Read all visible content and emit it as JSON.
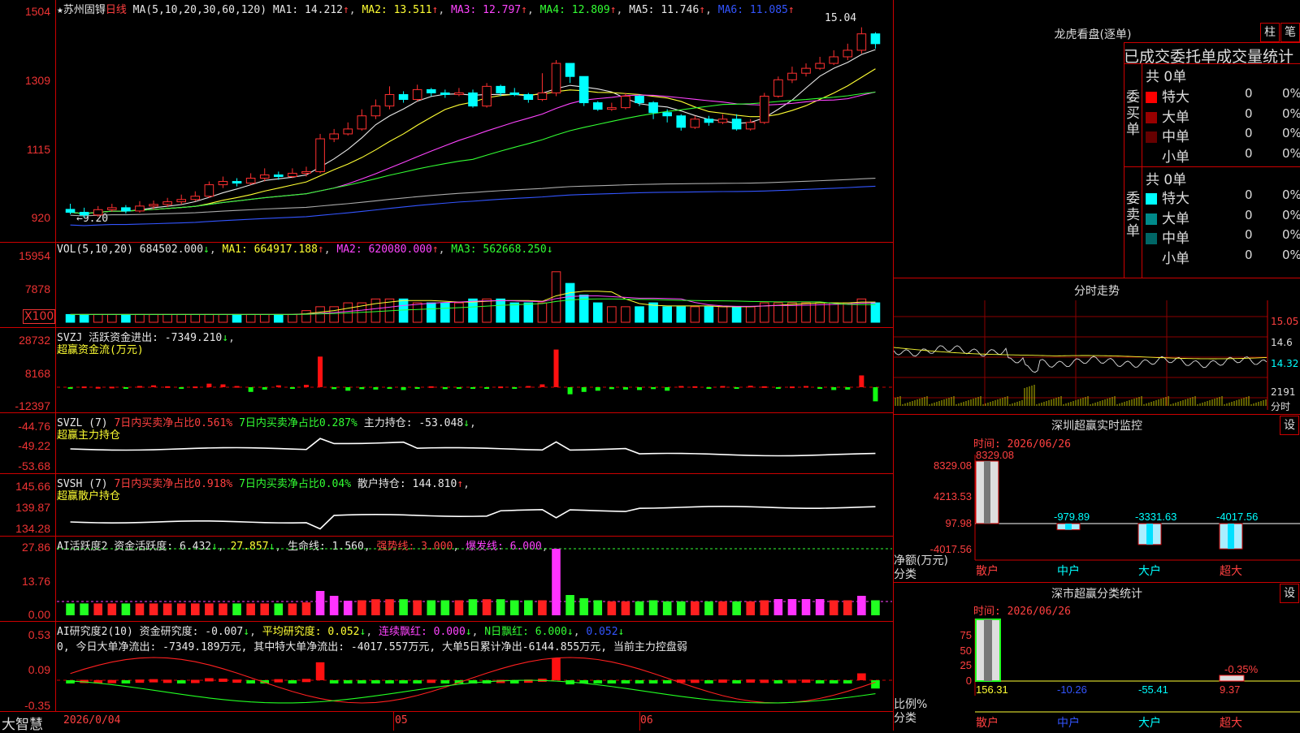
{
  "stock": {
    "name": "★苏州固锝",
    "period": "日线",
    "ma_label": "MA(5,10,20,30,60,120)"
  },
  "main_panel": {
    "ma_values": [
      {
        "label": "MA1: 14.212",
        "color": "#e8e8e8"
      },
      {
        "label": "MA2: 13.511",
        "color": "#ffff33"
      },
      {
        "label": "MA3: 12.797",
        "color": "#ff44ff"
      },
      {
        "label": "MA4: 12.809",
        "color": "#33ff33"
      },
      {
        "label": "MA5: 11.746",
        "color": "#e8e8e8"
      },
      {
        "label": "MA6: 11.085",
        "color": "#3355ff"
      }
    ],
    "y_ticks": [
      "1504",
      "1309",
      "1115",
      "920"
    ],
    "high_label": "15.04",
    "low_label": "←9.20"
  },
  "vol_panel": {
    "header": "VOL(5,10,20)",
    "value": "684502.000",
    "ma1": "MA1: 664917.188",
    "ma2": "MA2: 620080.000",
    "ma3": "MA3: 562668.250",
    "y_ticks": [
      "15954",
      "7878"
    ],
    "unit": "X100"
  },
  "svzj_panel": {
    "header": "SVZJ  活跃资金进出: -7349.210",
    "sub": "超赢资金流(万元)",
    "y_ticks": [
      "28732",
      "8168",
      "-12397"
    ]
  },
  "svzl_panel": {
    "header": "SVZL (7)",
    "p1": "7日内买卖净占比0.561%",
    "p2": "7日内买卖净占比0.287%",
    "p3": "主力持仓: -53.048",
    "sub": "超赢主力持仓",
    "y_ticks": [
      "-44.76",
      "-49.22",
      "-53.68"
    ]
  },
  "svsh_panel": {
    "header": "SVSH (7)",
    "p1": "7日内买卖净占比0.918%",
    "p2": "7日内买卖净占比0.04%",
    "p3": "散户持仓: 144.810",
    "sub": "超赢散户持仓",
    "y_ticks": [
      "145.66",
      "139.87",
      "134.28"
    ]
  },
  "ai_active_panel": {
    "header": "AI活跃度2 资金活跃度: 6.432",
    "v2": "27.857",
    "v3": "生命线: 1.560",
    "v4": "强势线: 3.000",
    "v5": "爆发线: 6.000",
    "y_ticks": [
      "27.86",
      "13.76",
      "0.00"
    ]
  },
  "ai_research_panel": {
    "header": "AI研究度2(10) 资金研究度: -0.007",
    "v2": "平均研究度: 0.052",
    "v3": "连续飘红: 0.000",
    "v4": "N日飘红: 6.000",
    "v5": "0.052",
    "note": "0, 今日大单净流出: -7349.189万元, 其中特大单净流出: -4017.557万元, 大单5日累计净出-6144.855万元, 当前主力控盘弱",
    "y_ticks": [
      "0.53",
      "0.09",
      "-0.35"
    ]
  },
  "x_axis": {
    "labels": [
      "2026/0/04",
      "05",
      "06"
    ]
  },
  "brand": "大智慧",
  "right_panel": {
    "lhb": {
      "title": "龙虎看盘(逐单)",
      "btn1": "柱",
      "btn2": "笔",
      "header": "已成交委托单成交量统计",
      "buy_label": "委买单",
      "sell_label": "委卖单",
      "buy_total": "共 0单",
      "sell_total": "共 0单",
      "buy_rows": [
        {
          "name": "特大",
          "count": "0",
          "pct": "0%",
          "color": "#ff0000"
        },
        {
          "name": "大单",
          "count": "0",
          "pct": "0%",
          "color": "#990000"
        },
        {
          "name": "中单",
          "count": "0",
          "pct": "0%",
          "color": "#660000"
        },
        {
          "name": "小单",
          "count": "0",
          "pct": "0%",
          "color": "#000000"
        }
      ],
      "sell_rows": [
        {
          "name": "特大",
          "count": "0",
          "pct": "0%",
          "color": "#00ffff"
        },
        {
          "name": "大单",
          "count": "0",
          "pct": "0%",
          "color": "#008a8a"
        },
        {
          "name": "中单",
          "count": "0",
          "pct": "0%",
          "color": "#006666"
        },
        {
          "name": "小单",
          "count": "0",
          "pct": "0%",
          "color": "#000000"
        }
      ]
    },
    "intraday": {
      "title": "分时走势",
      "ticks": [
        "15.05",
        "14.6",
        "14.32",
        "2191",
        "分时"
      ]
    },
    "monitor": {
      "title": "深圳超赢实时监控",
      "btn": "设",
      "time": "时间: 2026/06/26",
      "y_ticks": [
        "8329.08",
        "4213.53",
        "97.98",
        "-4017.56"
      ],
      "ylabel": "净额(万元)",
      "xlabel": "分类",
      "bars": [
        {
          "cat": "散户",
          "value": "8329.08"
        },
        {
          "cat": "中户",
          "value": "-979.89"
        },
        {
          "cat": "大户",
          "value": "-3331.63"
        },
        {
          "cat": "超大",
          "value": "-4017.56"
        }
      ]
    },
    "classify": {
      "title": "深市超赢分类统计",
      "btn": "设",
      "time": "时间: 2026/06/26",
      "y_ticks": [
        "75",
        "50",
        "25",
        "0"
      ],
      "ylabel": "比例%",
      "xlabel": "分类",
      "bars": [
        {
          "cat": "散户",
          "value": "156.31"
        },
        {
          "cat": "中户",
          "value": "-10.26"
        },
        {
          "cat": "大户",
          "value": "-55.41"
        },
        {
          "cat": "超大",
          "value": "9.37"
        }
      ],
      "top_label": "-0.35%"
    }
  },
  "chart_data": {
    "type": "candlestick",
    "ylim": [
      9.2,
      15.04
    ],
    "candles": [
      [
        9.45,
        9.36,
        9.62,
        9.3
      ],
      [
        9.36,
        9.28,
        9.5,
        9.2
      ],
      [
        9.28,
        9.44,
        9.55,
        9.22
      ],
      [
        9.44,
        9.5,
        9.62,
        9.38
      ],
      [
        9.5,
        9.4,
        9.58,
        9.32
      ],
      [
        9.4,
        9.55,
        9.7,
        9.35
      ],
      [
        9.55,
        9.6,
        9.72,
        9.45
      ],
      [
        9.6,
        9.68,
        9.8,
        9.52
      ],
      [
        9.68,
        9.75,
        9.9,
        9.6
      ],
      [
        9.75,
        9.85,
        10.0,
        9.7
      ],
      [
        9.85,
        10.2,
        10.3,
        9.8
      ],
      [
        10.2,
        10.3,
        10.45,
        10.1
      ],
      [
        10.3,
        10.25,
        10.4,
        10.15
      ],
      [
        10.25,
        10.4,
        10.55,
        10.2
      ],
      [
        10.4,
        10.5,
        10.7,
        10.3
      ],
      [
        10.5,
        10.45,
        10.6,
        10.35
      ],
      [
        10.45,
        10.55,
        10.7,
        10.4
      ],
      [
        10.55,
        10.6,
        10.75,
        10.45
      ],
      [
        10.6,
        11.6,
        11.75,
        10.55
      ],
      [
        11.6,
        11.75,
        11.9,
        11.5
      ],
      [
        11.75,
        11.9,
        12.1,
        11.7
      ],
      [
        11.9,
        12.3,
        12.5,
        11.85
      ],
      [
        12.3,
        12.6,
        12.8,
        12.2
      ],
      [
        12.6,
        12.95,
        13.2,
        12.5
      ],
      [
        12.95,
        12.8,
        13.05,
        12.7
      ],
      [
        12.8,
        13.1,
        13.25,
        12.75
      ],
      [
        13.1,
        13.0,
        13.15,
        12.9
      ],
      [
        13.0,
        12.95,
        13.1,
        12.85
      ],
      [
        12.95,
        13.0,
        13.15,
        12.9
      ],
      [
        13.0,
        12.6,
        13.1,
        12.55
      ],
      [
        12.6,
        13.2,
        13.3,
        12.55
      ],
      [
        13.2,
        13.0,
        13.25,
        12.9
      ],
      [
        13.0,
        12.95,
        13.15,
        12.9
      ],
      [
        12.95,
        12.8,
        13.0,
        12.7
      ],
      [
        12.8,
        13.0,
        13.6,
        12.75
      ],
      [
        13.0,
        13.9,
        14.0,
        12.9
      ],
      [
        13.9,
        13.5,
        13.9,
        13.3
      ],
      [
        13.5,
        12.7,
        13.5,
        12.6
      ],
      [
        12.7,
        12.5,
        12.75,
        12.45
      ],
      [
        12.5,
        12.55,
        12.7,
        12.45
      ],
      [
        12.55,
        12.9,
        13.0,
        12.5
      ],
      [
        12.9,
        12.7,
        12.95,
        12.6
      ],
      [
        12.7,
        12.4,
        12.75,
        12.2
      ],
      [
        12.4,
        12.3,
        12.5,
        12.1
      ],
      [
        12.3,
        11.95,
        12.35,
        11.85
      ],
      [
        11.95,
        12.2,
        12.3,
        11.9
      ],
      [
        12.2,
        12.1,
        12.3,
        12.0
      ],
      [
        12.1,
        12.2,
        12.35,
        12.05
      ],
      [
        12.2,
        11.9,
        12.35,
        11.85
      ],
      [
        11.9,
        12.1,
        12.2,
        11.85
      ],
      [
        12.1,
        12.9,
        13.0,
        12.05
      ],
      [
        12.9,
        13.4,
        13.5,
        12.85
      ],
      [
        13.4,
        13.6,
        13.8,
        13.3
      ],
      [
        13.6,
        13.75,
        13.9,
        13.5
      ],
      [
        13.75,
        13.9,
        14.1,
        13.7
      ],
      [
        13.9,
        14.1,
        14.3,
        13.85
      ],
      [
        14.1,
        14.3,
        14.5,
        14.0
      ],
      [
        14.3,
        14.8,
        15.0,
        14.2
      ],
      [
        14.8,
        14.5,
        14.85,
        14.35
      ]
    ],
    "volume": [
      2,
      2,
      2,
      2,
      2,
      2,
      2,
      2,
      2,
      2,
      2,
      2,
      2,
      2,
      2,
      2,
      2,
      3,
      4,
      4,
      5,
      5,
      6,
      6,
      6,
      5,
      5,
      5,
      5,
      6,
      6,
      6,
      5,
      5,
      5,
      13,
      10,
      7,
      5,
      4,
      4,
      4,
      5,
      4,
      4,
      4,
      4,
      4,
      4,
      4,
      5,
      5,
      5,
      5,
      5,
      5,
      5,
      6,
      5
    ],
    "svzj": [
      -0.5,
      0.3,
      0.1,
      0.2,
      -0.3,
      0.5,
      0.8,
      0.4,
      -0.6,
      0.3,
      1.5,
      1.2,
      0.5,
      -2,
      -1,
      0.8,
      -0.4,
      1,
      13,
      -0.8,
      -1.5,
      -0.8,
      -1,
      -0.6,
      -1.2,
      -0.5,
      0.4,
      -0.8,
      -0.6,
      -0.5,
      -0.4,
      0.3,
      -0.4,
      0.5,
      1.2,
      16,
      -3,
      -2,
      -1.5,
      -0.8,
      -1,
      -1.2,
      -0.8,
      -1.5,
      0.5,
      0.4,
      -0.3,
      0.5,
      -0.4,
      0.6,
      0.4,
      -0.6,
      0.3,
      0.5,
      -0.5,
      -1.2,
      -1,
      5,
      -6
    ]
  }
}
